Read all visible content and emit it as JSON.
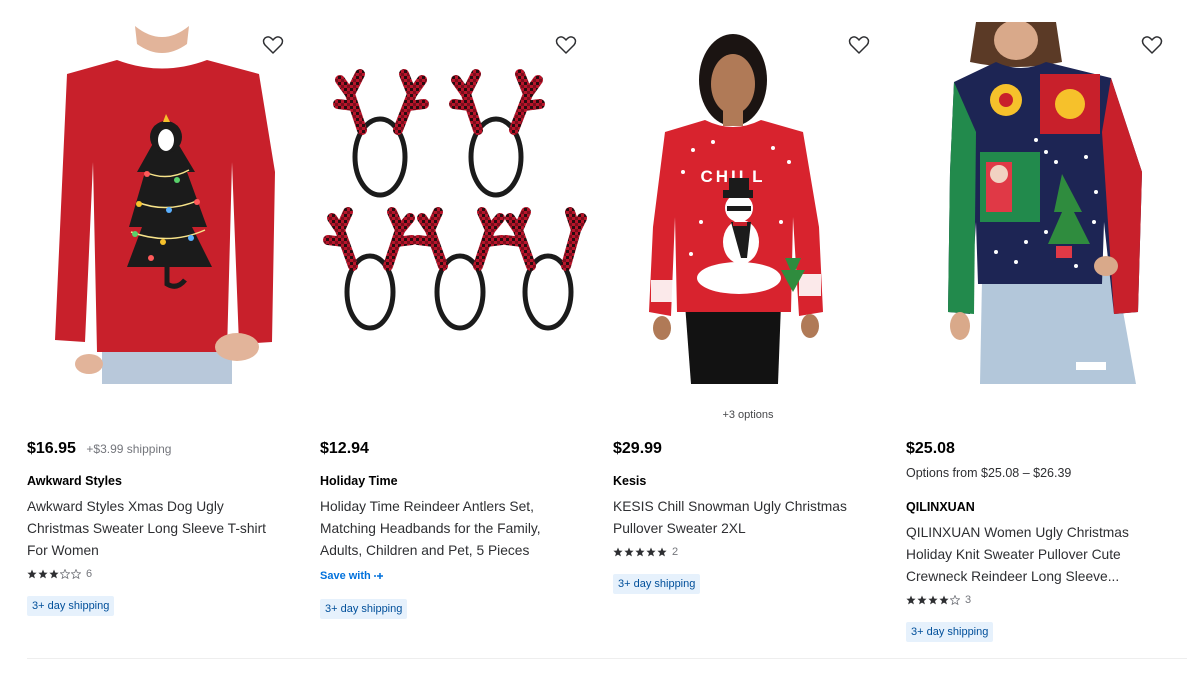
{
  "products": [
    {
      "price": "$16.95",
      "shipping_note": "+$3.99 shipping",
      "brand": "Awkward Styles",
      "title": "Awkward Styles Xmas Dog Ugly Christmas Sweater Long Sleeve T-shirt For Women",
      "rating": 3,
      "review_count": "6",
      "badge": "3+ day shipping",
      "image_subject": "red long sleeve t-shirt with dog christmas tree"
    },
    {
      "price": "$12.94",
      "brand": "Holiday Time",
      "title": "Holiday Time Reindeer Antlers Set, Matching Headbands for the Family, Adults, Children and Pet, 5 Pieces",
      "save_with": "Save with",
      "badge": "3+ day shipping",
      "image_subject": "five plaid reindeer antler headbands"
    },
    {
      "options_note": "+3 options",
      "price": "$29.99",
      "brand": "Kesis",
      "title": "KESIS Chill Snowman Ugly Christmas Pullover Sweater 2XL",
      "rating": 5,
      "review_count": "2",
      "badge": "3+ day shipping",
      "sweater_text": "CHILL",
      "image_subject": "woman in red chill snowman sweater"
    },
    {
      "price": "$25.08",
      "options_range": "Options from $25.08 – $26.39",
      "brand": "QILINXUAN",
      "title": "QILINXUAN Women Ugly Christmas Holiday Knit Sweater Pullover Cute Crewneck Reindeer Long Sleeve...",
      "rating": 4,
      "review_count": "3",
      "badge": "3+ day shipping",
      "image_subject": "woman in patchwork christmas knit sweater"
    }
  ],
  "icons": {
    "favorite": "heart-outline-icon",
    "star": "star-icon",
    "plus": "walmart-plus-icon"
  },
  "colors": {
    "link_blue": "#0071dc",
    "badge_bg": "#e6f1fc",
    "badge_text": "#004f9a",
    "sweater_red": "#c8202b"
  }
}
